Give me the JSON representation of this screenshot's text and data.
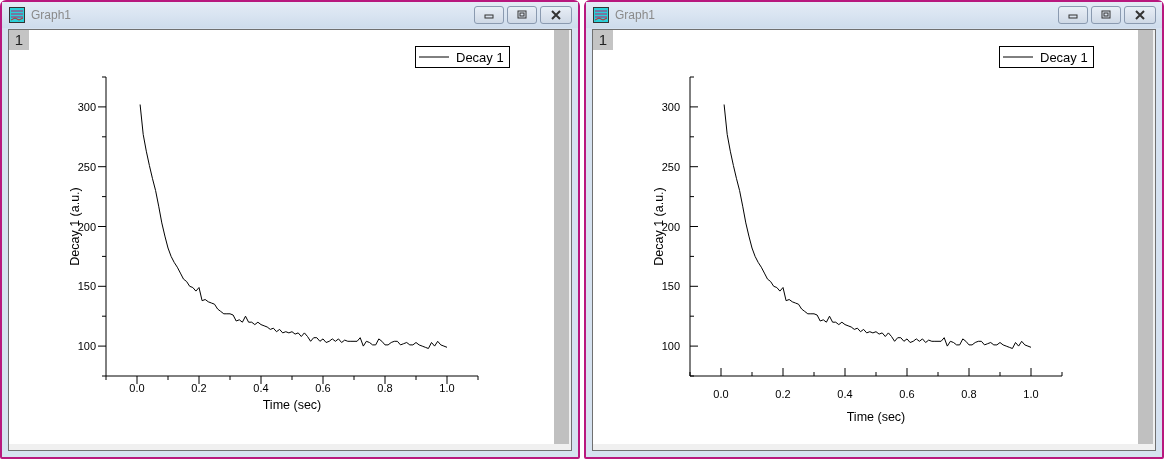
{
  "windows": [
    {
      "title": "Graph1",
      "layer": "1",
      "ticks_inside": false,
      "chart_data": {
        "type": "line",
        "xlabel": "Time (sec)",
        "ylabel": "Decay 1 (a.u.)",
        "xlim": [
          -0.1,
          1.1
        ],
        "ylim": [
          75,
          325
        ],
        "xticks": [
          {
            "value": 0,
            "label": "0.0"
          },
          {
            "value": 0.2,
            "label": "0.2"
          },
          {
            "value": 0.4,
            "label": "0.4"
          },
          {
            "value": 0.6,
            "label": "0.6"
          },
          {
            "value": 0.8,
            "label": "0.8"
          },
          {
            "value": 1,
            "label": "1.0"
          }
        ],
        "yticks": [
          100,
          150,
          200,
          250,
          300
        ],
        "x": [
          0.01,
          0.02,
          0.03,
          0.04,
          0.05,
          0.06,
          0.07,
          0.08,
          0.09,
          0.1,
          0.11,
          0.12,
          0.13,
          0.14,
          0.15,
          0.16,
          0.17,
          0.18,
          0.19,
          0.2,
          0.21,
          0.22,
          0.23,
          0.24,
          0.25,
          0.26,
          0.27,
          0.28,
          0.29,
          0.3,
          0.31,
          0.32,
          0.33,
          0.34,
          0.35,
          0.36,
          0.37,
          0.38,
          0.39,
          0.4,
          0.41,
          0.42,
          0.43,
          0.44,
          0.45,
          0.46,
          0.47,
          0.48,
          0.49,
          0.5,
          0.51,
          0.52,
          0.53,
          0.54,
          0.55,
          0.56,
          0.57,
          0.58,
          0.59,
          0.6,
          0.61,
          0.62,
          0.63,
          0.64,
          0.65,
          0.66,
          0.67,
          0.68,
          0.69,
          0.7,
          0.71,
          0.72,
          0.73,
          0.74,
          0.75,
          0.76,
          0.77,
          0.78,
          0.79,
          0.8,
          0.81,
          0.82,
          0.83,
          0.84,
          0.85,
          0.86,
          0.87,
          0.88,
          0.89,
          0.9,
          0.91,
          0.92,
          0.93,
          0.94,
          0.95,
          0.96,
          0.97,
          0.98,
          0.99,
          1.0
        ],
        "series": [
          {
            "name": "Decay 1",
            "color": "#000000",
            "values": [
              302,
              277,
              263,
              251,
              240,
              230,
              217,
              203,
              192,
              182,
              175,
              170,
              166,
              161,
              156,
              154,
              150,
              149,
              146,
              149,
              138,
              139,
              137,
              136,
              135,
              131,
              129,
              127,
              127,
              127,
              126,
              121,
              122,
              120,
              125,
              120,
              120,
              118,
              120,
              118,
              117,
              116,
              114,
              115,
              112,
              114,
              111,
              112,
              111,
              112,
              110,
              111,
              108,
              111,
              108,
              104,
              107,
              107,
              104,
              106,
              103,
              104,
              106,
              104,
              106,
              103,
              105,
              104,
              104,
              104,
              104,
              107,
              100,
              104,
              103,
              101,
              101,
              106,
              104,
              101,
              101,
              103,
              104,
              104,
              101,
              102,
              103,
              101,
              101,
              103,
              101,
              100,
              99,
              98,
              103,
              100,
              104,
              101,
              100,
              99
            ]
          }
        ]
      }
    },
    {
      "title": "Graph1",
      "layer": "1",
      "ticks_inside": true,
      "chart_data": {
        "type": "line",
        "xlabel": "Time (sec)",
        "ylabel": "Decay 1 (a.u.)",
        "xlim": [
          -0.1,
          1.1
        ],
        "ylim": [
          75,
          325
        ],
        "xticks": [
          {
            "value": 0,
            "label": "0.0"
          },
          {
            "value": 0.2,
            "label": "0.2"
          },
          {
            "value": 0.4,
            "label": "0.4"
          },
          {
            "value": 0.6,
            "label": "0.6"
          },
          {
            "value": 0.8,
            "label": "0.8"
          },
          {
            "value": 1,
            "label": "1.0"
          }
        ],
        "yticks": [
          100,
          150,
          200,
          250,
          300
        ],
        "x": [
          0.01,
          0.02,
          0.03,
          0.04,
          0.05,
          0.06,
          0.07,
          0.08,
          0.09,
          0.1,
          0.11,
          0.12,
          0.13,
          0.14,
          0.15,
          0.16,
          0.17,
          0.18,
          0.19,
          0.2,
          0.21,
          0.22,
          0.23,
          0.24,
          0.25,
          0.26,
          0.27,
          0.28,
          0.29,
          0.3,
          0.31,
          0.32,
          0.33,
          0.34,
          0.35,
          0.36,
          0.37,
          0.38,
          0.39,
          0.4,
          0.41,
          0.42,
          0.43,
          0.44,
          0.45,
          0.46,
          0.47,
          0.48,
          0.49,
          0.5,
          0.51,
          0.52,
          0.53,
          0.54,
          0.55,
          0.56,
          0.57,
          0.58,
          0.59,
          0.6,
          0.61,
          0.62,
          0.63,
          0.64,
          0.65,
          0.66,
          0.67,
          0.68,
          0.69,
          0.7,
          0.71,
          0.72,
          0.73,
          0.74,
          0.75,
          0.76,
          0.77,
          0.78,
          0.79,
          0.8,
          0.81,
          0.82,
          0.83,
          0.84,
          0.85,
          0.86,
          0.87,
          0.88,
          0.89,
          0.9,
          0.91,
          0.92,
          0.93,
          0.94,
          0.95,
          0.96,
          0.97,
          0.98,
          0.99,
          1.0
        ],
        "series": [
          {
            "name": "Decay 1",
            "color": "#000000",
            "values": [
              302,
              277,
              263,
              251,
              240,
              230,
              217,
              203,
              192,
              182,
              175,
              170,
              166,
              161,
              156,
              154,
              150,
              149,
              146,
              149,
              138,
              139,
              137,
              136,
              135,
              131,
              129,
              127,
              127,
              127,
              126,
              121,
              122,
              120,
              125,
              120,
              120,
              118,
              120,
              118,
              117,
              116,
              114,
              115,
              112,
              114,
              111,
              112,
              111,
              112,
              110,
              111,
              108,
              111,
              108,
              104,
              107,
              107,
              104,
              106,
              103,
              104,
              106,
              104,
              106,
              103,
              105,
              104,
              104,
              104,
              104,
              107,
              100,
              104,
              103,
              101,
              101,
              106,
              104,
              101,
              101,
              103,
              104,
              104,
              101,
              102,
              103,
              101,
              101,
              103,
              101,
              100,
              99,
              98,
              103,
              100,
              104,
              101,
              100,
              99
            ]
          }
        ]
      }
    }
  ]
}
